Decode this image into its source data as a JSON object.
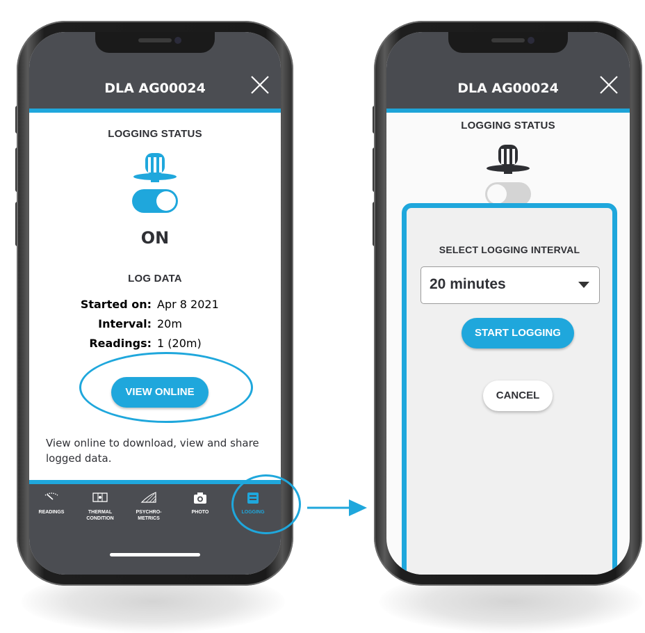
{
  "colors": {
    "accent": "#1fa7dc",
    "header": "#4b4d52",
    "text": "#2f3035"
  },
  "left_phone": {
    "title": "DLA AG00024",
    "close_icon": "close-icon",
    "logging_status_title": "LOGGING STATUS",
    "toggle_state_text": "ON",
    "log_data_title": "LOG DATA",
    "log_rows": [
      {
        "label": "Started on:",
        "value": "Apr 8 2021"
      },
      {
        "label": "Interval:",
        "value": "20m"
      },
      {
        "label": "Readings:",
        "value": "1 (20m)"
      }
    ],
    "view_online_label": "VIEW ONLINE",
    "description": "View online to download, view and share logged data.",
    "tabs": [
      {
        "label": "READINGS",
        "icon": "gauge-icon"
      },
      {
        "label": "THERMAL CONDITION",
        "icon": "thermal-icon"
      },
      {
        "label": "PSYCHRO-METRICS",
        "icon": "psychrometric-chart-icon"
      },
      {
        "label": "PHOTO",
        "icon": "camera-icon"
      },
      {
        "label": "LOGGING",
        "icon": "logging-icon",
        "active": true
      }
    ]
  },
  "right_phone": {
    "title": "DLA AG00024",
    "close_icon": "close-icon",
    "logging_status_title": "LOGGING STATUS",
    "modal": {
      "title": "SELECT LOGGING INTERVAL",
      "selected_interval": "20 minutes",
      "start_label": "START LOGGING",
      "cancel_label": "CANCEL"
    }
  }
}
